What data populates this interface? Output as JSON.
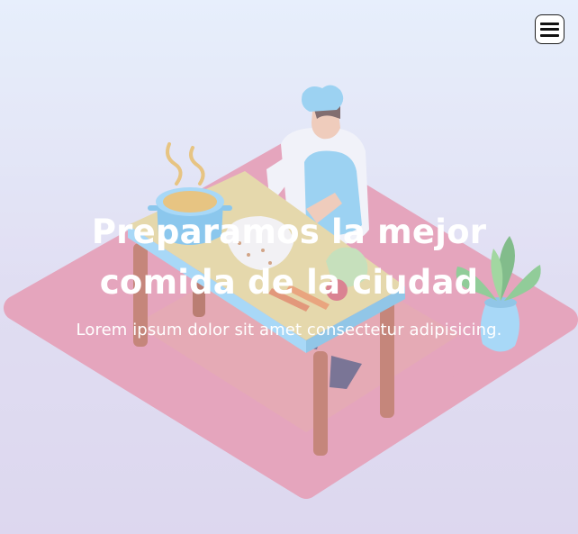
{
  "header": {
    "menu_icon": "hamburger-icon"
  },
  "hero": {
    "title": "Preparamos la mejor comida de la ciudad",
    "subtitle": "Lorem ipsum dolor sit amet consectetur adipisicing.",
    "illustration": "chef-cooking-illustration"
  },
  "colors": {
    "background_top": "#e6f0fc",
    "background_bottom": "#d8cfea",
    "floor": "#e38aa5",
    "table_top": "#e4d08e",
    "table_legs": "#b85f4a",
    "chef_apron": "#7ec8ef",
    "pot": "#67b9e8",
    "plant_vase": "#8fd0f5",
    "text": "#ffffff"
  }
}
